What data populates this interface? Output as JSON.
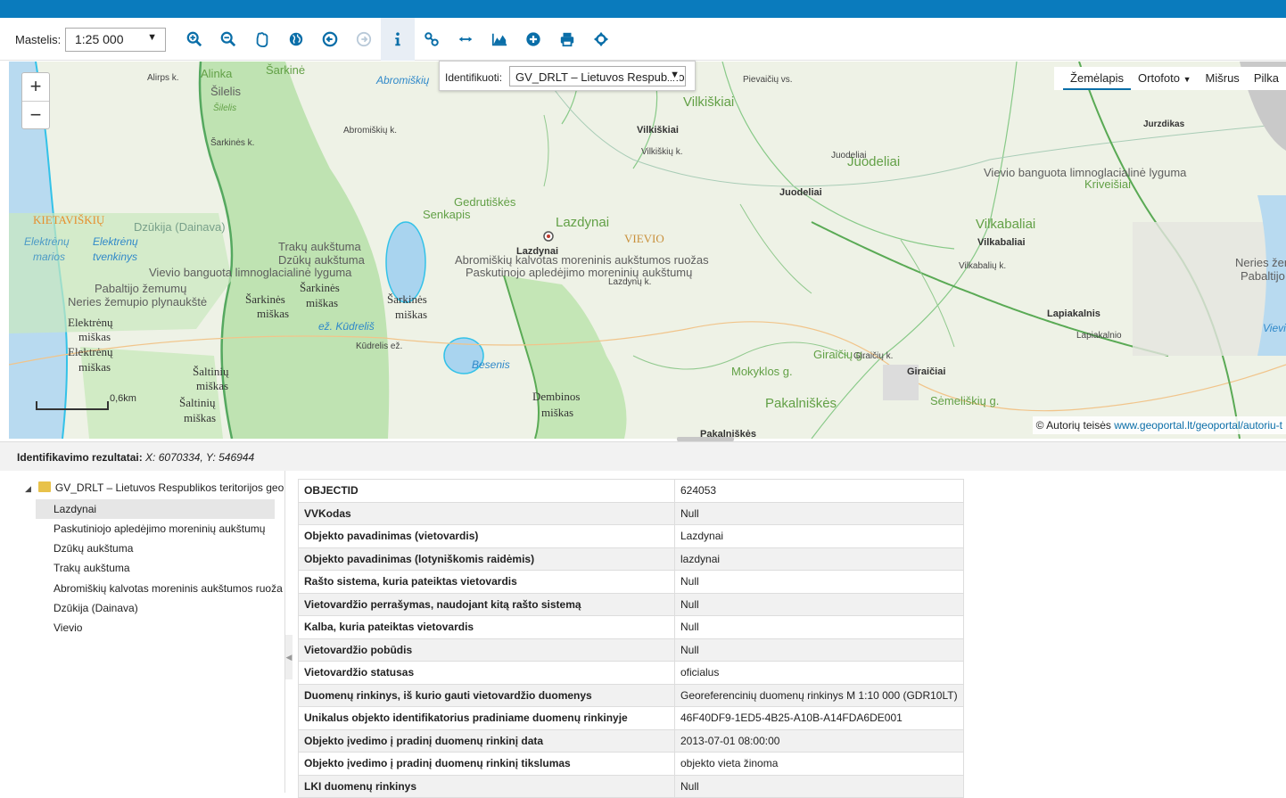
{
  "toolbar": {
    "scale_label": "Mastelis:",
    "scale_value": "1:25 000",
    "tools": [
      "zoom-in",
      "zoom-out",
      "pan",
      "full-extent",
      "previous-extent",
      "next-extent",
      "identify",
      "link",
      "measure",
      "profile",
      "add-data",
      "print",
      "locate"
    ]
  },
  "identify": {
    "label": "Identifikuoti:",
    "value": "GV_DRLT – Lietuvos Respublikos teritorijos geo"
  },
  "map": {
    "basemaps": [
      "Žemėlapis",
      "Ortofoto",
      "Mišrus",
      "Pilka"
    ],
    "selected_basemap": "Žemėlapis",
    "scale_bar": "0,6km",
    "copyright_prefix": "© Autorių teisės",
    "copyright_link": "www.geoportal.lt/geoportal/autoriu-t",
    "labels": {
      "l1": "Alinka",
      "l2": "Šarkinė",
      "l3": "Alirps k.",
      "l4": "Šilelis",
      "l5": "Šilelis",
      "l6": "Abromiškių k.",
      "l7": "Abromiškių",
      "l8": "Šarkinės k.",
      "l9": "Vilkiškiai",
      "l10": "Vilkiškiai",
      "l11": "Vilkiškių k.",
      "l12": "Pievaičių vs.",
      "l13": "Juodeliai",
      "l14": "Juodeliai",
      "l15": "Juodeliai",
      "l16": "Vievio banguota limnoglacialinė lyguma",
      "l17": "Kriveišiai",
      "l18": "Jurzdikas",
      "l19": "KIETAVIŠKIŲ",
      "l20": "Dzūkija (Dainava)",
      "l21": "Elektrėnų",
      "l22": "Elektrėnų",
      "l23": "marios",
      "l24": "tvenkinys",
      "l25": "Lazdynai",
      "l26": "Lazdynai",
      "l27": "Senkapis",
      "l28": "Gedrutiškės",
      "l29": "VIEVIO",
      "l30": "Vilkabaliai",
      "l31": "Vilkabaliai",
      "l32": "Vilkabalių k.",
      "l33": "Trakų aukštuma",
      "l34": "Dzūkų aukštuma",
      "l35": "Abromiškių kalvotas moreninis aukštumos ruožas",
      "l36": "Vievio banguota limnoglacialinė lyguma",
      "l37": "Paskutinojo apledėjimo moreninių aukštumų",
      "l38": "Lazdynų k.",
      "l39": "Pabaltijo žemumų",
      "l40": "Neries žemupio plynaukštė",
      "l41": "Šarkinės",
      "l42": "Šarkinės",
      "l43": "miškas",
      "l44": "miškas",
      "l45": "Šarkinės",
      "l46": "miškas",
      "l47": "Elektrėnų",
      "l48": "miškas",
      "l49": "Elektrėnų",
      "l50": "miškas",
      "l51": "ež. Kūdreliš",
      "l52": "Kūdrelis ež.",
      "l53": "Šaltinių",
      "l54": "miškas",
      "l55": "Šaltinių",
      "l56": "miškas",
      "l57": "Besenis",
      "l58": "Dembinos",
      "l59": "miškas",
      "l60": "Mokyklos g.",
      "l61": "Giraičių g.",
      "l62": "Giraičių k.",
      "l63": "Giraičiai",
      "l64": "Lapiakalnis",
      "l65": "Lapiakalnio",
      "l66": "Pakalniškės",
      "l67": "Pakalniškės",
      "l68": "Neries žem.",
      "l69": "Pabaltijo",
      "l70": "Vievis",
      "l71": "Sėmeliškių g."
    }
  },
  "results": {
    "title": "Identifikavimo rezultatai:",
    "coords": "X: 6070334, Y: 546944",
    "root": "GV_DRLT – Lietuvos Respublikos teritorijos geo",
    "items": [
      "Lazdynai",
      "Paskutiniojo apledėjimo moreninių aukštumų",
      "Dzūkų aukštuma",
      "Trakų aukštuma",
      "Abromiškių kalvotas moreninis aukštumos ruoža",
      "Dzūkija (Dainava)",
      "Vievio"
    ],
    "attributes": [
      [
        "OBJECTID",
        "624053"
      ],
      [
        "VVKodas",
        "Null"
      ],
      [
        "Objekto pavadinimas (vietovardis)",
        "Lazdynai"
      ],
      [
        "Objekto pavadinimas (lotyniškomis raidėmis)",
        "lazdynai"
      ],
      [
        "Rašto sistema, kuria pateiktas vietovardis",
        "Null"
      ],
      [
        "Vietovardžio perrašymas, naudojant kitą rašto sistemą",
        "Null"
      ],
      [
        "Kalba, kuria pateiktas vietovardis",
        "Null"
      ],
      [
        "Vietovardžio pobūdis",
        "Null"
      ],
      [
        "Vietovardžio statusas",
        "oficialus"
      ],
      [
        "Duomenų rinkinys, iš kurio gauti vietovardžio duomenys",
        "Georeferencinių duomenų rinkinys M 1:10 000 (GDR10LT)"
      ],
      [
        "Unikalus objekto identifikatorius pradiniame duomenų rinkinyje",
        "46F40DF9-1ED5-4B25-A10B-A14FDA6DE001"
      ],
      [
        "Objekto įvedimo į pradinį duomenų rinkinį data",
        "2013-07-01 08:00:00"
      ],
      [
        "Objekto įvedimo į pradinį duomenų rinkinį tikslumas",
        "objekto vieta žinoma"
      ],
      [
        "LKI duomenų rinkinys",
        "Null"
      ]
    ]
  }
}
